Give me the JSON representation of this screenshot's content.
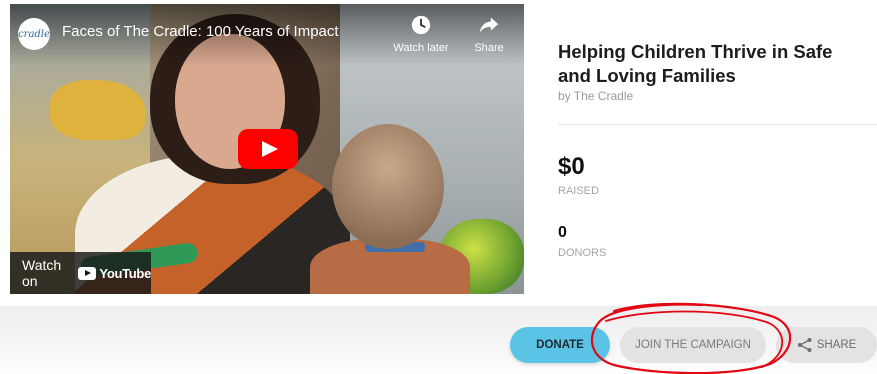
{
  "video": {
    "title": "Faces of The Cradle: 100 Years of Impact",
    "channel_logo_text": "cradle",
    "watch_later_label": "Watch later",
    "share_label": "Share",
    "watch_on_label": "Watch on",
    "youtube_label": "YouTube",
    "icons": [
      "clock-icon",
      "share-arrow-icon",
      "play-icon",
      "youtube-logo"
    ],
    "play_button_color": "#FF0000"
  },
  "campaign": {
    "title": "Helping Children Thrive in Safe and Loving Families",
    "byline": "by The Cradle",
    "raised_amount": "$0",
    "raised_label": "RAISED",
    "donors_count": "0",
    "donors_label": "DONORS"
  },
  "actions": {
    "donate_label": "DONATE",
    "join_label": "JOIN THE CAMPAIGN",
    "share_label": "SHARE",
    "donate_color": "#5BC3E6",
    "secondary_color": "#E3E3E3"
  },
  "annotation": {
    "type": "hand-drawn circle",
    "color": "#E30613",
    "target": "JOIN THE CAMPAIGN"
  }
}
